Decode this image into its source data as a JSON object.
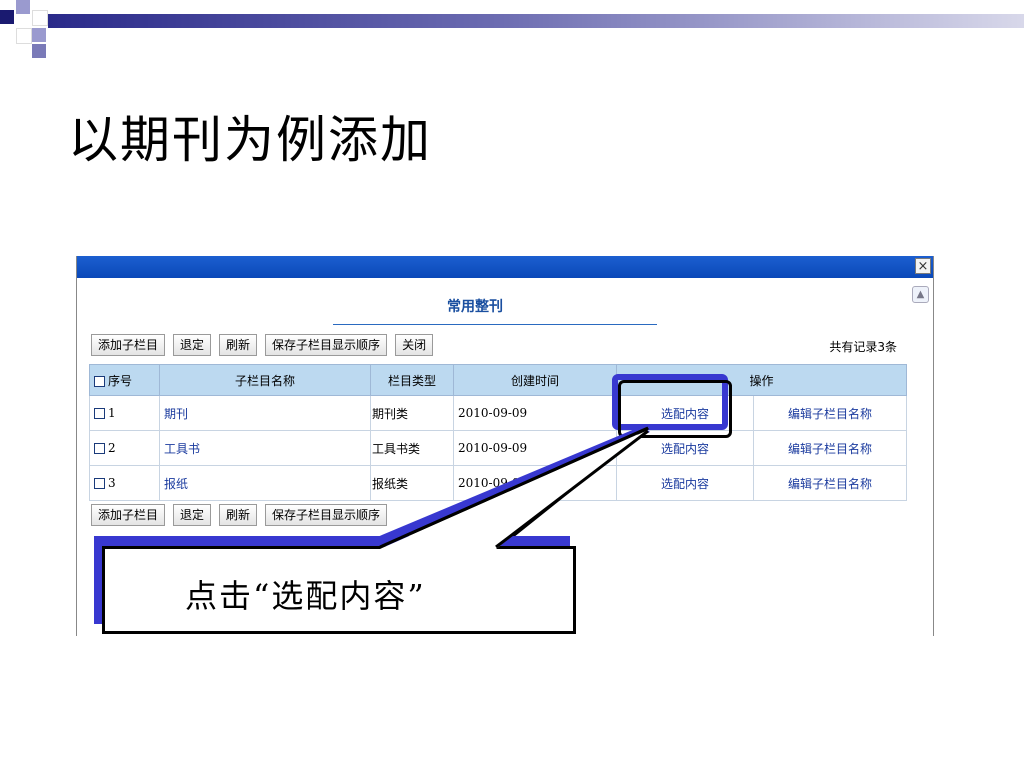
{
  "slide": {
    "title": "以期刊为例添加"
  },
  "dialog": {
    "close_icon": "×",
    "panel_title": "常用整刊",
    "record_count": "共有记录3条",
    "toolbar": [
      {
        "label": "添加子栏目"
      },
      {
        "label": "退定"
      },
      {
        "label": "刷新"
      },
      {
        "label": "保存子栏目显示顺序"
      },
      {
        "label": "关闭"
      }
    ],
    "toolbar_bottom": [
      {
        "label": "添加子栏目"
      },
      {
        "label": "退定"
      },
      {
        "label": "刷新"
      },
      {
        "label": "保存子栏目显示顺序"
      }
    ],
    "columns": {
      "seq": "序号",
      "name": "子栏目名称",
      "type": "栏目类型",
      "created": "创建时间",
      "ops": "操作"
    },
    "rows": [
      {
        "seq": "1",
        "name": "期刊",
        "type": "期刊类",
        "created": "2010-09-09",
        "op1": "选配内容",
        "op2": "编辑子栏目名称"
      },
      {
        "seq": "2",
        "name": "工具书",
        "type": "工具书类",
        "created": "2010-09-09",
        "op1": "选配内容",
        "op2": "编辑子栏目名称"
      },
      {
        "seq": "3",
        "name": "报纸",
        "type": "报纸类",
        "created": "2010-09-09",
        "op1": "选配内容",
        "op2": "编辑子栏目名称"
      }
    ]
  },
  "callout": {
    "text": "点击“选配内容”"
  },
  "colors": {
    "titlebar": "#0a48b8",
    "header_bg": "#bcd9f0",
    "link": "#1a3a9e",
    "callout_shadow": "#3838d0"
  }
}
